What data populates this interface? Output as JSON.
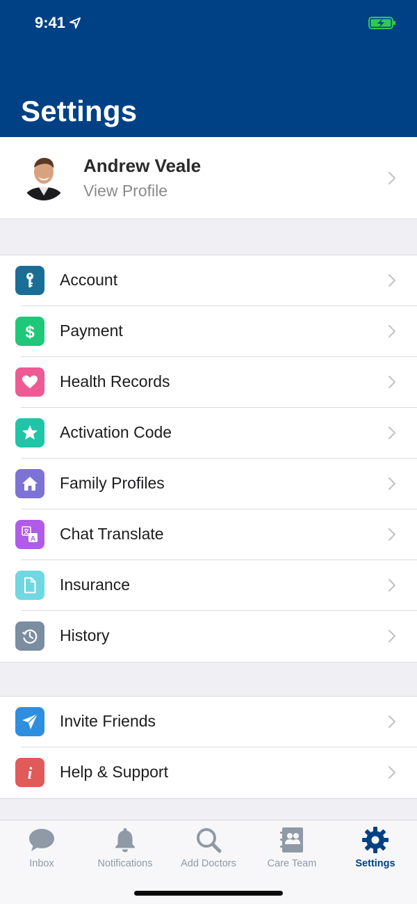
{
  "status_bar": {
    "time": "9:41"
  },
  "header": {
    "title": "Settings"
  },
  "profile": {
    "name": "Andrew Veale",
    "subtitle": "View Profile"
  },
  "menu_group_1": [
    {
      "label": "Account",
      "icon": "key-icon",
      "color": "#1a6e96"
    },
    {
      "label": "Payment",
      "icon": "dollar-icon",
      "color": "#1ec878"
    },
    {
      "label": "Health Records",
      "icon": "heart-icon",
      "color": "#f05a94"
    },
    {
      "label": "Activation Code",
      "icon": "star-icon",
      "color": "#20c4a6"
    },
    {
      "label": "Family Profiles",
      "icon": "home-icon",
      "color": "#7d72d6"
    },
    {
      "label": "Chat Translate",
      "icon": "translate-icon",
      "color": "#b15ce8"
    },
    {
      "label": "Insurance",
      "icon": "document-icon",
      "color": "#6fd8e0"
    },
    {
      "label": "History",
      "icon": "history-icon",
      "color": "#7b8da0"
    }
  ],
  "menu_group_2": [
    {
      "label": "Invite Friends",
      "icon": "paper-plane-icon",
      "color": "#2e8fe0"
    },
    {
      "label": "Help & Support",
      "icon": "info-icon",
      "color": "#e05a5a"
    }
  ],
  "tabbar": {
    "items": [
      {
        "label": "Inbox",
        "icon": "chat-bubble-icon"
      },
      {
        "label": "Notifications",
        "icon": "bell-icon"
      },
      {
        "label": "Add Doctors",
        "icon": "search-icon"
      },
      {
        "label": "Care Team",
        "icon": "contacts-icon"
      },
      {
        "label": "Settings",
        "icon": "gear-icon",
        "active": true
      }
    ],
    "active_color": "#004185",
    "inactive_color": "#8f9aa6"
  }
}
